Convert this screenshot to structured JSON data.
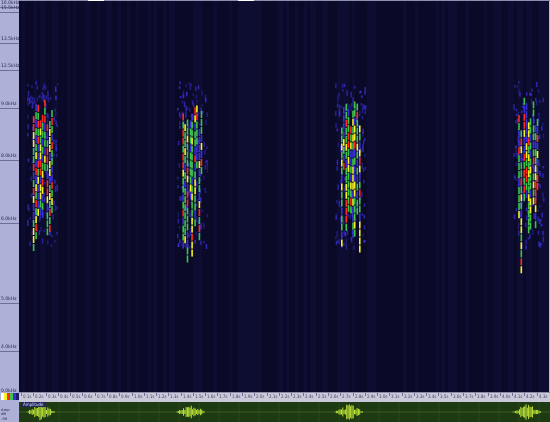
{
  "frequency_axis": {
    "labels": [
      {
        "text": "16.0kHz",
        "key": "f16"
      },
      {
        "text": "15.5kHz",
        "key": "f155"
      },
      {
        "text": "13.5kHz",
        "key": "f135"
      },
      {
        "text": "12.5kHz",
        "key": "f125"
      },
      {
        "text": "9.0kHz",
        "key": "f9"
      },
      {
        "text": "8.0kHz",
        "key": "f8"
      },
      {
        "text": "6.0kHz",
        "key": "f6"
      },
      {
        "text": "5.0kHz",
        "key": "f5"
      },
      {
        "text": "4.0kHz",
        "key": "f4"
      },
      {
        "text": "0.0kHz",
        "key": "f0"
      }
    ]
  },
  "time_axis": {
    "labels": [
      "0.1s",
      "0.2s",
      "0.3s",
      "0.4s",
      "0.5s",
      "0.6s",
      "0.7s",
      "0.8s",
      "0.9s",
      "1.0s",
      "1.1s",
      "1.2s",
      "1.3s",
      "1.4s",
      "1.5s",
      "1.6s",
      "1.7s",
      "1.8s",
      "1.9s",
      "2.0s",
      "2.1s",
      "2.2s",
      "2.3s",
      "2.4s",
      "2.5s",
      "2.6s",
      "2.7s",
      "2.8s",
      "2.9s",
      "3.0s",
      "3.1s",
      "3.2s",
      "3.3s",
      "3.4s",
      "3.5s",
      "3.6s",
      "3.7s",
      "3.8s",
      "3.9s",
      "4.0s",
      "4.1s",
      "4.2s",
      "4.3s"
    ]
  },
  "waveform": {
    "title": "Amplitude"
  },
  "corner": {
    "waveform_label_1": "Amp",
    "waveform_label_2": "dB",
    "waveform_label_3": "-99"
  },
  "colors": {
    "background": "#0b0b2c",
    "low": "#3a2fd6",
    "mid": "#3ec24a",
    "high": "#f5f21f",
    "peak": "#ff2a1a",
    "waveform_bg": "#1e3a12",
    "waveform_signal": "#c9f03a"
  },
  "palette": [
    "#ffffff",
    "#f5f21f",
    "#ff2a1a",
    "#3ec24a",
    "#3a2fd6",
    "#1c1c6a"
  ]
}
